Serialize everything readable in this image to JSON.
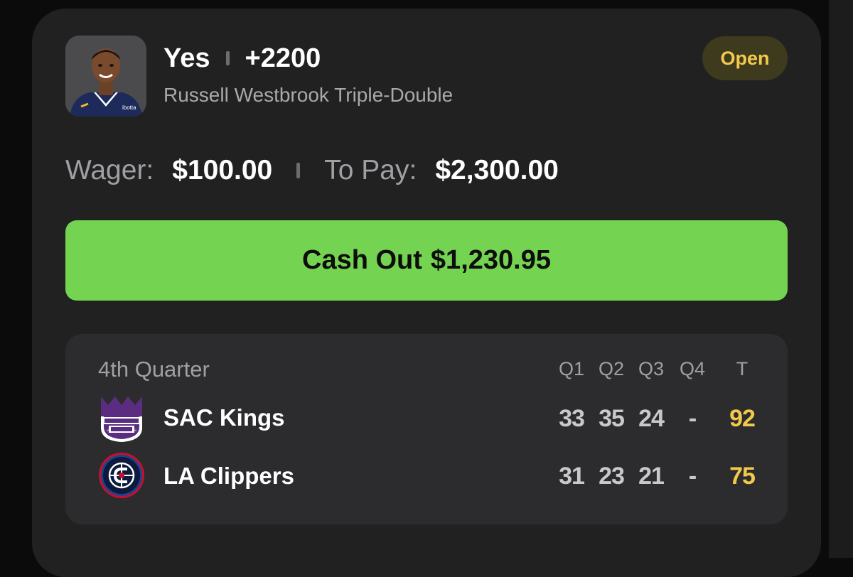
{
  "bet": {
    "selection": "Yes",
    "odds": "+2200",
    "market": "Russell Westbrook Triple-Double",
    "status": "Open"
  },
  "wager": {
    "wager_label": "Wager:",
    "wager_value": "$100.00",
    "to_pay_label": "To Pay:",
    "to_pay_value": "$2,300.00"
  },
  "cashout": {
    "label": "Cash Out",
    "amount": "$1,230.95"
  },
  "scoreboard": {
    "period": "4th Quarter",
    "headers": [
      "Q1",
      "Q2",
      "Q3",
      "Q4",
      "T"
    ],
    "teams": [
      {
        "name": "SAC Kings",
        "logo": "kings-logo",
        "scores": [
          "33",
          "35",
          "24",
          "-"
        ],
        "total": "92"
      },
      {
        "name": "LA Clippers",
        "logo": "clippers-logo",
        "scores": [
          "31",
          "23",
          "21",
          "-"
        ],
        "total": "75"
      }
    ]
  },
  "colors": {
    "card_bg": "#212122",
    "cashout_green": "#74d350",
    "open_badge_text": "#f2c94c",
    "total_score": "#f2c94c"
  }
}
